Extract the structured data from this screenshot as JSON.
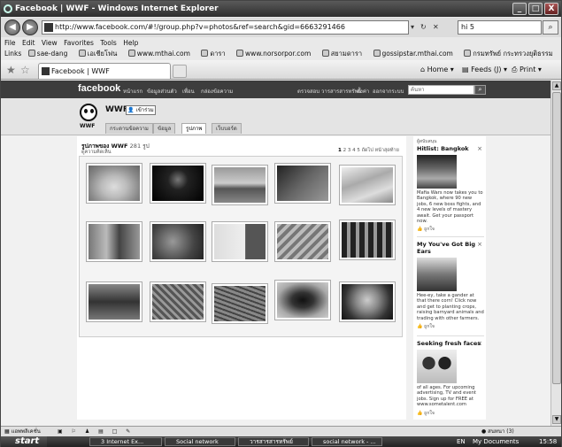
{
  "window": {
    "title": "Facebook | WWF - Windows Internet Explorer",
    "min": "_",
    "max": "□",
    "close": "X"
  },
  "address": {
    "url": "http://www.facebook.com/#!/group.php?v=photos&ref=search&gid=6663291466",
    "search_value": "hi 5"
  },
  "menu": [
    "File",
    "Edit",
    "View",
    "Favorites",
    "Tools",
    "Help"
  ],
  "links": {
    "label": "Links",
    "items": [
      "sae-dang",
      "เอเชียโฟน",
      "www.mthai.com",
      "ดารา",
      "www.norsorpor.com",
      "สยามดารา",
      "gossipstar.mthai.com",
      "กรมทรัพย์ กระทรวงยุติธรรม"
    ]
  },
  "tab": {
    "label": "Facebook | WWF"
  },
  "commands": {
    "home": "Home",
    "feeds": "Feeds (J)",
    "print": "Print"
  },
  "fb": {
    "logo": "facebook",
    "nav": [
      "หน้าแรก",
      "ข้อมูลส่วนตัว",
      "เพื่อน",
      "กล่องข้อความ"
    ],
    "right_nav": [
      "ตรวจสอบ วารสารสารทรัพย์",
      "ตั้งค่า",
      "ออกจากระบบ"
    ],
    "search_placeholder": "ค้นหา"
  },
  "group": {
    "name": "WWF",
    "join_label": "เข้าร่วม",
    "logo_text": "WWF",
    "tabs": [
      "กระดานข้อความ",
      "ข้อมูล",
      "รูปภาพ",
      "เว็บบอร์ด"
    ],
    "active_tab": 2
  },
  "photos": {
    "title": "รูปภาพของ WWF",
    "count": "281 รูป",
    "back": "ดูความคิดเห็น",
    "pages": [
      "1",
      "2",
      "3",
      "4",
      "5"
    ],
    "next": "ถัดไป",
    "last": "หน้าสุดท้าย"
  },
  "sidebar": {
    "header": "ผู้สนับสนุน",
    "ads": [
      {
        "title": "Hitlist: Bangkok",
        "body": "Mafia Wars now takes you to Bangkok, where 90 new jobs, 6 new boss fights, and 4 new levels of mastery await. Get your passport now.",
        "like": "ถูกใจ"
      },
      {
        "title": "My You've Got Big Ears",
        "body": "Hee-ey, take a gander at that there corn! Click now and get to planting crops, raising barnyard animals and trading with other farmers.",
        "like": "ถูกใจ"
      },
      {
        "title": "Seeking fresh faces",
        "body": "of all ages. For upcoming advertising, TV and event jobs. Sign up for FREE at www.sometalent.com",
        "like": "ถูกใจ"
      }
    ]
  },
  "fb_bottom": {
    "left": "แอพพลิเคชั่น",
    "chat": "สนทนา (3)"
  },
  "taskbar": {
    "start": "start",
    "tasks": [
      "3 Internet Ex...",
      "Social network",
      "วารสารสารทรัพย์",
      "social network - ..."
    ],
    "lang": "EN",
    "docs": "My Documents",
    "clock": "15:58"
  }
}
